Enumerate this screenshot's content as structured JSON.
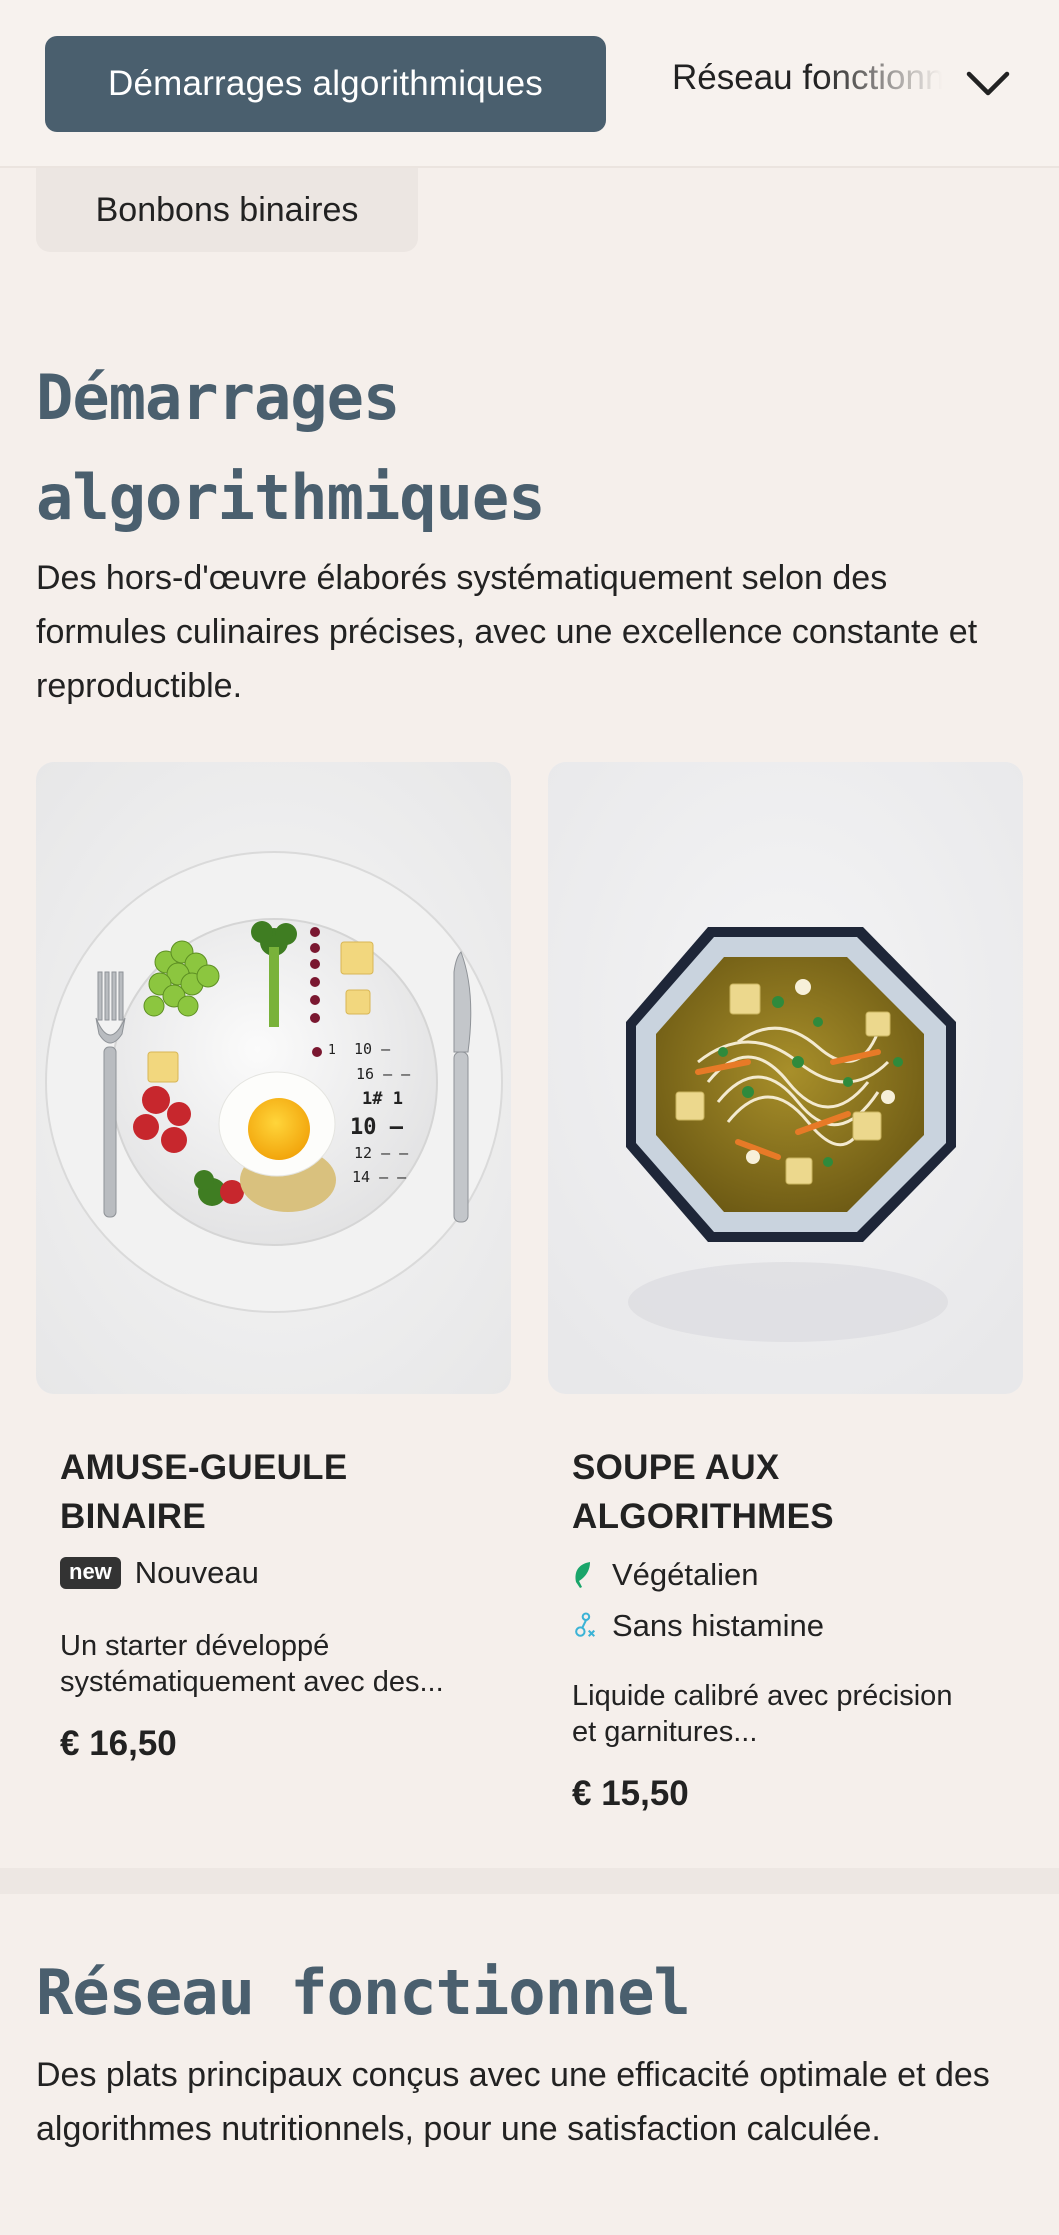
{
  "nav": {
    "active_tab": "Démarrages algorithmiques",
    "next_tab": "Réseau fonctionnel",
    "dropdown_icon": "chevron-down-icon",
    "pill": "Bonbons binaires"
  },
  "section1": {
    "title_line1": "Démarrages",
    "title_line2": "algorithmiques",
    "description": "Des hors-d'œuvre élaborés systématiquement selon des formules culinaires précises, avec une excellence constante et reproductible."
  },
  "cards": [
    {
      "title_line1": "AMUSE-GUEULE",
      "title_line2": "BINAIRE",
      "badge": "new",
      "tag": "Nouveau",
      "desc_line1": "Un starter développé",
      "desc_line2": "systématiquement avec des...",
      "price": "€ 16,50",
      "plate_numbers": [
        "1",
        "10 –",
        "16 – –",
        "1# 1",
        "10 —",
        "12 – –",
        "14 – –"
      ]
    },
    {
      "title_line1": "SOUPE AUX",
      "title_line2": "ALGORITHMES",
      "tags": [
        {
          "icon": "leaf-icon",
          "label": "Végétalien"
        },
        {
          "icon": "histamine-icon",
          "label": "Sans histamine"
        }
      ],
      "desc_line1": "Liquide calibré avec précision",
      "desc_line2": "et garnitures...",
      "price": "€ 15,50"
    }
  ],
  "section2": {
    "title": "Réseau fonctionnel",
    "description": "Des plats principaux conçus avec une efficacité optimale et des algorithmes nutritionnels, pour une satisfaction calculée."
  },
  "colors": {
    "background": "#f5efeb",
    "accent": "#4a5f6e",
    "leaf": "#1aa56a",
    "histamine": "#3bb3d6"
  }
}
